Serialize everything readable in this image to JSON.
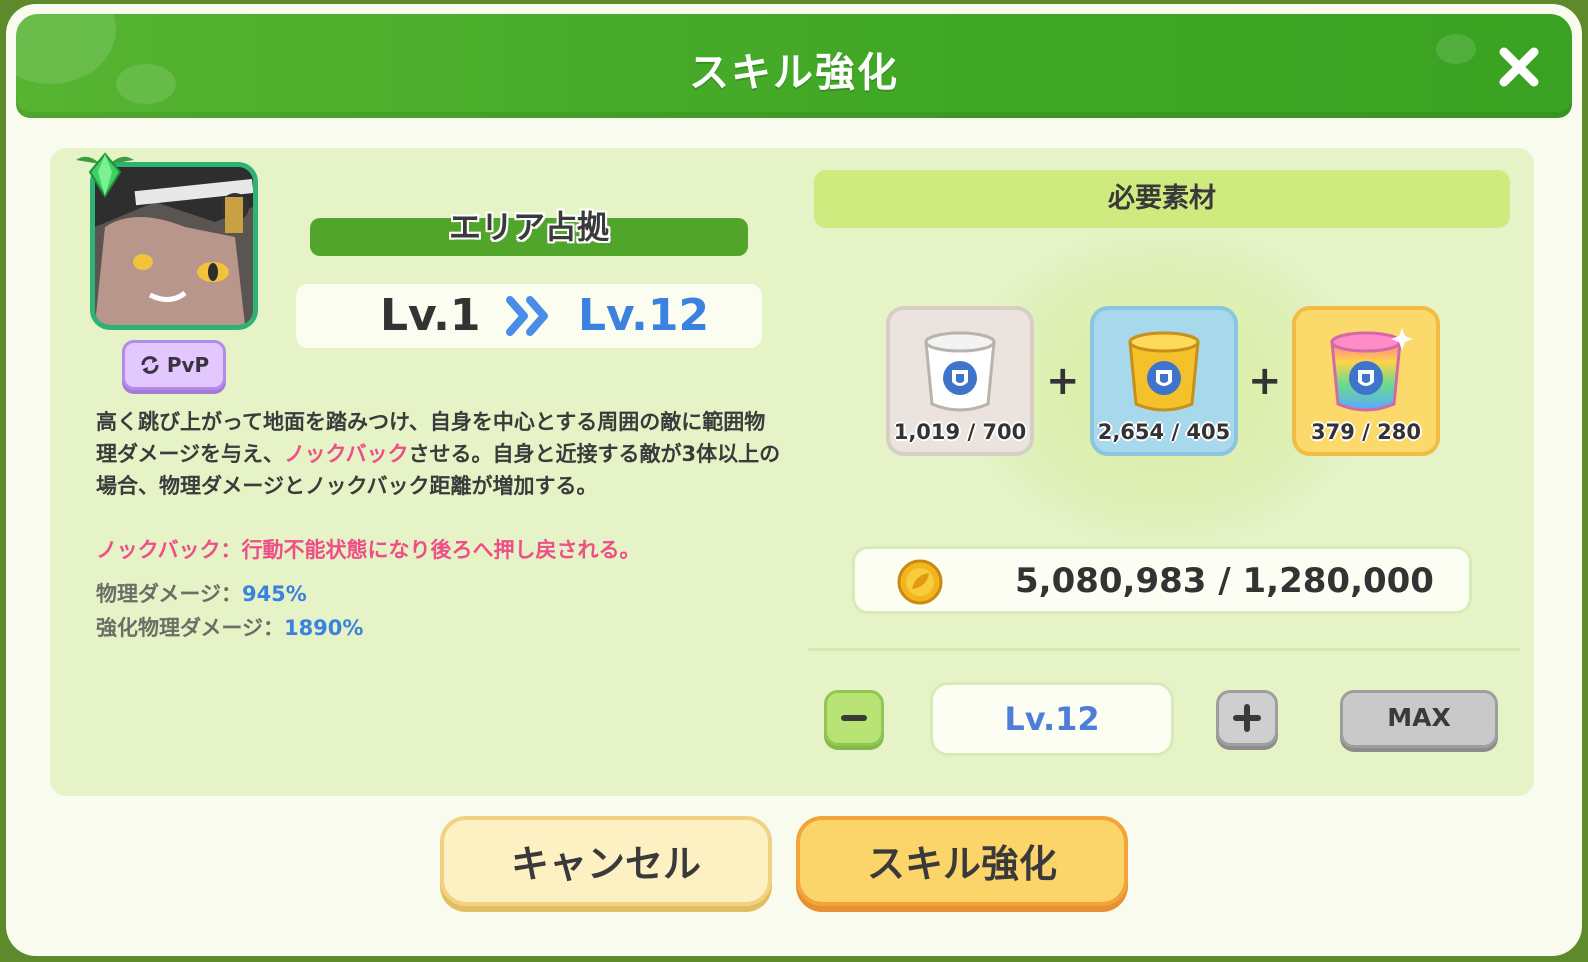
{
  "header": {
    "title": "スキル強化"
  },
  "skill": {
    "name": "エリア占拠",
    "pvp_label": "PvP",
    "level_from": "Lv.1",
    "level_to": "Lv.12",
    "description_part1": "高く跳び上がって地面を踏みつけ、自身を中心とする周囲の敵に範囲物理ダメージを与え、",
    "description_highlight": "ノックバック",
    "description_part2": "させる。自身と近接する敵が3体以上の場合、物理ダメージとノックバック距離が増加する。",
    "note": "ノックバック：行動不能状態になり後ろへ押し戻される。",
    "stats": [
      {
        "label": "物理ダメージ：",
        "value": "945%"
      },
      {
        "label": "強化物理ダメージ：",
        "value": "1890%"
      }
    ]
  },
  "materials": {
    "title": "必要素材",
    "items": [
      {
        "name": "white-jar",
        "count": "1,019 / 700",
        "color": "#ffffff"
      },
      {
        "name": "gold-jar",
        "count": "2,654 / 405",
        "color": "#f5c12a"
      },
      {
        "name": "rainbow-jar",
        "count": "379 / 280",
        "color": "#ff6fb0"
      }
    ],
    "plus": "+"
  },
  "coins": {
    "text": "5,080,983 / 1,280,000"
  },
  "level_selector": {
    "value": "Lv.12",
    "max_label": "MAX"
  },
  "buttons": {
    "cancel": "キャンセル",
    "confirm": "スキル強化"
  },
  "colors": {
    "header_green": "#45ab28",
    "panel": "#e5f3c7",
    "accent_blue": "#3b82e0",
    "accent_pink": "#ef4e86"
  }
}
